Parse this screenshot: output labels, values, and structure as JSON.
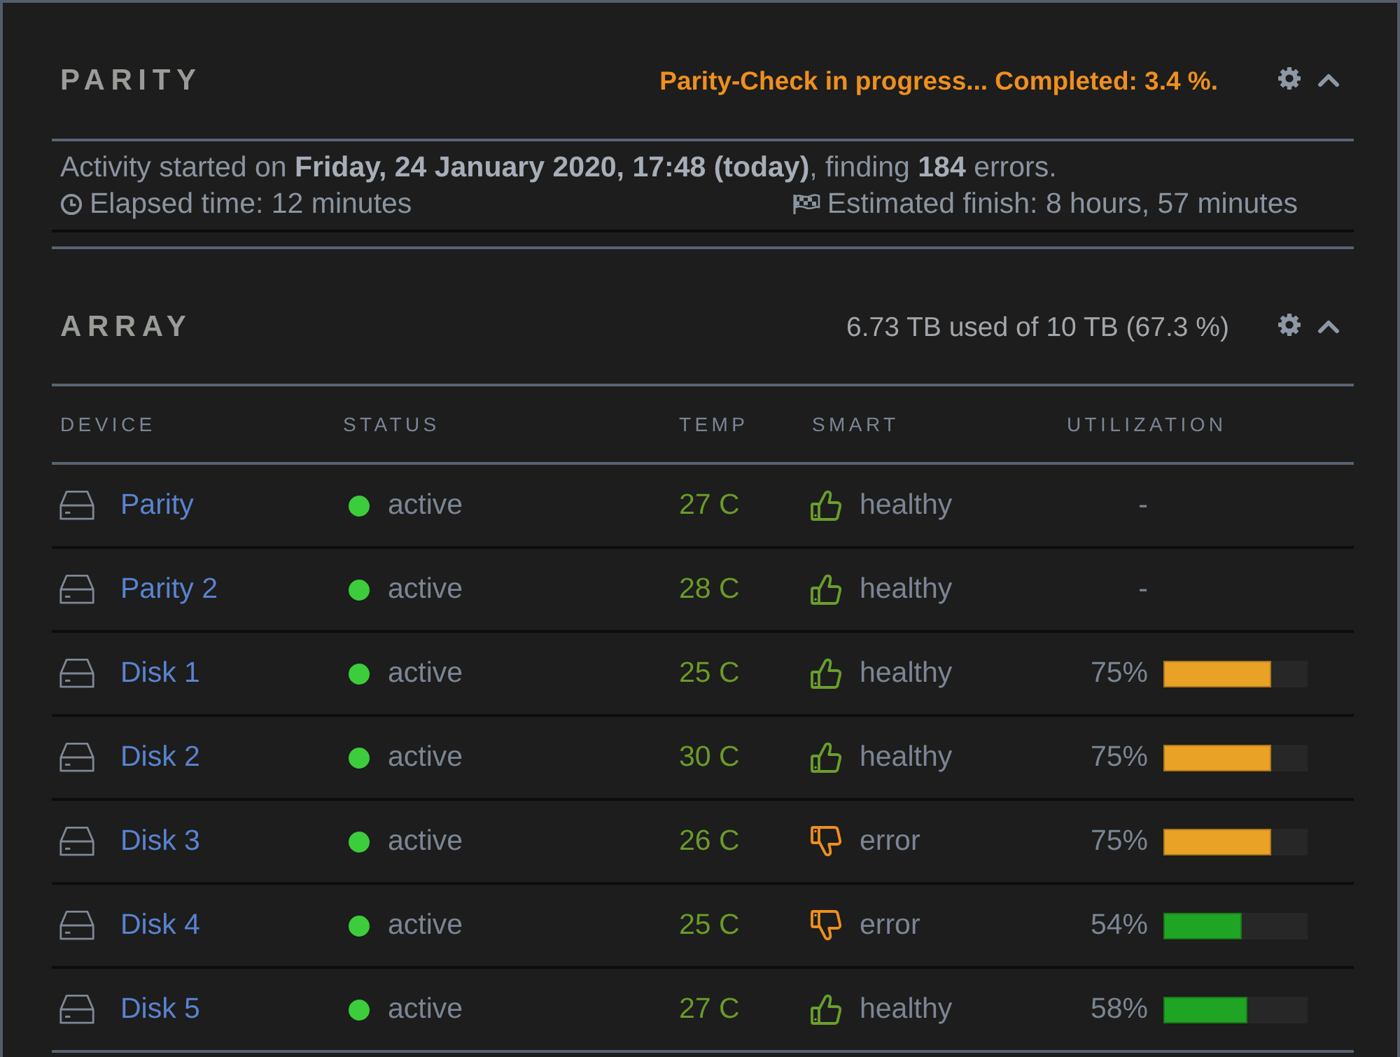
{
  "parity": {
    "title": "PARITY",
    "status": "Parity-Check in progress... Completed: 3.4 %.",
    "expanded": true,
    "activity": "Activity started on **Friday, 24 January 2020, 17:48 (today)**, finding **184** errors.",
    "elapsed": "Elapsed time: 12 minutes",
    "estimated_finish": "Estimated finish: 8 hours, 57 minutes"
  },
  "array": {
    "title": "ARRAY",
    "usage": "6.73 TB used of 10 TB (67.3 %)",
    "expanded": true,
    "table": {
      "columns": [
        "DEVICE",
        "STATUS",
        "TEMP",
        "SMART",
        "UTILIZATION"
      ],
      "rows": [
        {
          "device": "Parity",
          "status": {
            "label": "active",
            "color": "#3ccc3c"
          },
          "temp": "27 C",
          "smart": {
            "label": "healthy",
            "kind": "pass"
          },
          "utilization": {
            "label": "-"
          }
        },
        {
          "device": "Parity 2",
          "status": {
            "label": "active",
            "color": "#3ccc3c"
          },
          "temp": "28 C",
          "smart": {
            "label": "healthy",
            "kind": "pass"
          },
          "utilization": {
            "label": "-"
          }
        },
        {
          "device": "Disk 1",
          "status": {
            "label": "active",
            "color": "#3ccc3c"
          },
          "temp": "25 C",
          "smart": {
            "label": "healthy",
            "kind": "pass"
          },
          "utilization": {
            "label": "75%",
            "level": 0.75,
            "color": "#e9a126"
          }
        },
        {
          "device": "Disk 2",
          "status": {
            "label": "active",
            "color": "#3ccc3c"
          },
          "temp": "30 C",
          "smart": {
            "label": "healthy",
            "kind": "pass"
          },
          "utilization": {
            "label": "75%",
            "level": 0.75,
            "color": "#e9a126"
          }
        },
        {
          "device": "Disk 3",
          "status": {
            "label": "active",
            "color": "#3ccc3c"
          },
          "temp": "26 C",
          "smart": {
            "label": "error",
            "kind": "fail"
          },
          "utilization": {
            "label": "75%",
            "level": 0.75,
            "color": "#e9a126"
          }
        },
        {
          "device": "Disk 4",
          "status": {
            "label": "active",
            "color": "#3ccc3c"
          },
          "temp": "25 C",
          "smart": {
            "label": "error",
            "kind": "fail"
          },
          "utilization": {
            "label": "54%",
            "level": 0.54,
            "color": "#20a424"
          }
        },
        {
          "device": "Disk 5",
          "status": {
            "label": "active",
            "color": "#3ccc3c"
          },
          "temp": "27 C",
          "smart": {
            "label": "healthy",
            "kind": "pass"
          },
          "utilization": {
            "label": "58%",
            "level": 0.58,
            "color": "#20a424"
          }
        }
      ]
    }
  }
}
